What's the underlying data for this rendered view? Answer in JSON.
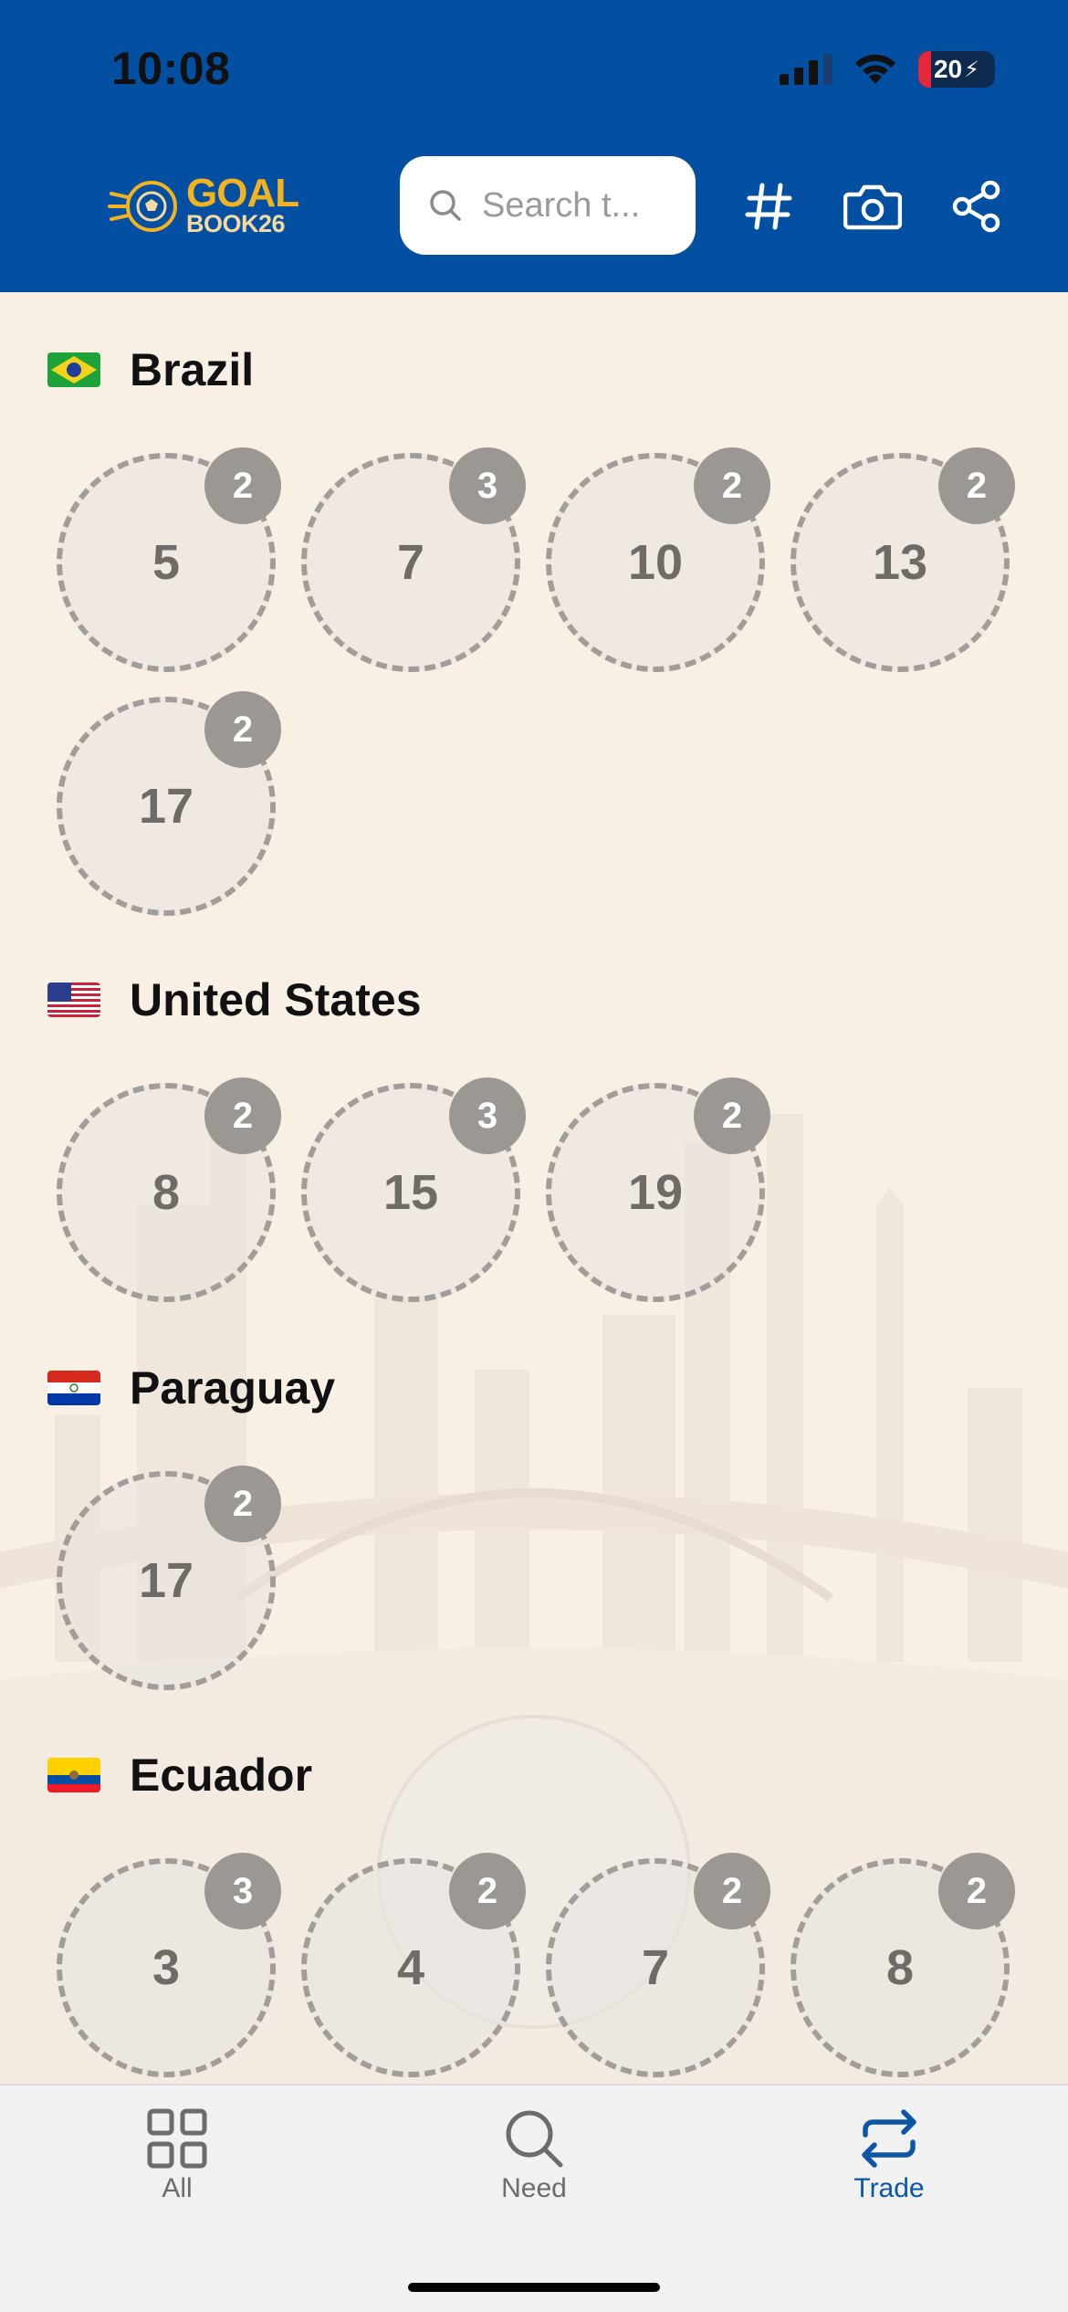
{
  "status_bar": {
    "time": "10:08",
    "battery": "20"
  },
  "header": {
    "logo_line1": "GOAL",
    "logo_line2": "BOOK26",
    "search_placeholder": "Search t...",
    "icons": [
      "search-icon",
      "hash-icon",
      "camera-icon",
      "share-icon"
    ]
  },
  "colors": {
    "header_bg": "#0350a2",
    "page_bg": "#f8efe5",
    "badge": "#9b9893",
    "active_tab": "#0a57a6",
    "logo_gold": "#f3b321"
  },
  "sections": [
    {
      "country": "Brazil",
      "flag": "brazil-flag",
      "stickers": [
        {
          "number": "5",
          "count": "2"
        },
        {
          "number": "7",
          "count": "3"
        },
        {
          "number": "10",
          "count": "2"
        },
        {
          "number": "13",
          "count": "2"
        },
        {
          "number": "17",
          "count": "2"
        }
      ]
    },
    {
      "country": "United States",
      "flag": "usa-flag",
      "stickers": [
        {
          "number": "8",
          "count": "2"
        },
        {
          "number": "15",
          "count": "3"
        },
        {
          "number": "19",
          "count": "2"
        }
      ]
    },
    {
      "country": "Paraguay",
      "flag": "paraguay-flag",
      "stickers": [
        {
          "number": "17",
          "count": "2"
        }
      ]
    },
    {
      "country": "Ecuador",
      "flag": "ecuador-flag",
      "stickers": [
        {
          "number": "3",
          "count": "3"
        },
        {
          "number": "4",
          "count": "2"
        },
        {
          "number": "7",
          "count": "2"
        },
        {
          "number": "8",
          "count": "2"
        }
      ]
    }
  ],
  "tabs": [
    {
      "label": "All",
      "icon": "grid-icon",
      "active": false
    },
    {
      "label": "Need",
      "icon": "search-icon",
      "active": false
    },
    {
      "label": "Trade",
      "icon": "swap-icon",
      "active": true
    }
  ]
}
